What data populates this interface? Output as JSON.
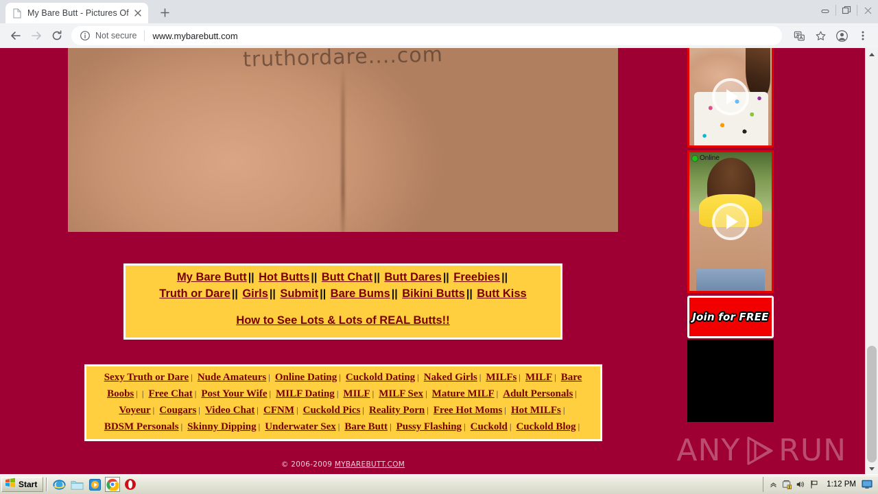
{
  "browser": {
    "tab": {
      "title": "My Bare Butt - Pictures Of College G",
      "favicon_name": "page-icon",
      "close_label": "✕"
    },
    "newtab_label": "+",
    "window_controls": {
      "minimize": "minimize",
      "restore": "restore",
      "close": "close"
    },
    "toolbar": {
      "back": "back",
      "forward": "forward",
      "reload": "reload",
      "security_text": "Not secure",
      "url": "www.mybarebutt.com",
      "translate": "translate",
      "bookmark": "bookmark",
      "profile": "profile",
      "menu": "menu"
    }
  },
  "page": {
    "background_color": "#9e0034",
    "hero": {
      "name": "hero-photo",
      "scrawl_text": "truthordare....com"
    },
    "navbox": {
      "background_color": "#ffcf3f",
      "row1": [
        "My Bare Butt",
        "Hot Butts",
        "Butt Chat",
        "Butt Dares",
        "Freebies"
      ],
      "row2": [
        "Truth or Dare",
        "Girls",
        "Submit",
        "Bare Bums",
        "Bikini Butts",
        "Butt Kiss"
      ],
      "separator": "||",
      "cta": "How to See Lots & Lots of REAL Butts!!"
    },
    "linkbox": {
      "background_color": "#ffcf3f",
      "separator": "|",
      "row1": [
        "Sexy Truth or Dare",
        "Nude Amateurs",
        "Online Dating",
        "Cuckold Dating",
        "Naked Girls",
        "MILFs",
        "MILF",
        "Bare"
      ],
      "row2": [
        "Boobs",
        "Free Chat",
        "Post Your Wife",
        "MILF Dating",
        "MILF",
        "MILF Sex",
        "Mature MILF",
        "Adult Personals"
      ],
      "row3": [
        "Voyeur",
        "Cougars",
        "Video Chat",
        "CFNM",
        "Cuckold Pics",
        "Reality Porn",
        "Free Hot Moms",
        "Hot MILFs"
      ],
      "row4": [
        "BDSM Personals",
        "Skinny Dipping",
        "Underwater Sex",
        "Bare Butt",
        "Pussy Flashing",
        "Cuckold",
        "Cuckold Blog"
      ]
    },
    "footer": {
      "copyright": "© 2006-2009 ",
      "site_link": "MYBAREBUTT.COM"
    },
    "sidebar": {
      "cam1": {
        "name": "cam-thumbnail-1",
        "play": "play"
      },
      "cam2": {
        "name": "cam-thumbnail-2",
        "play": "play",
        "status": "Online"
      },
      "join_banner": "Join for FREE"
    }
  },
  "watermark": {
    "left": "ANY",
    "right": "RUN"
  },
  "taskbar": {
    "start_label": "Start",
    "quicklaunch": [
      {
        "name": "internet-explorer-icon"
      },
      {
        "name": "folder-icon"
      },
      {
        "name": "media-player-icon"
      },
      {
        "name": "chrome-icon"
      },
      {
        "name": "opera-icon"
      }
    ],
    "tray": {
      "icons": [
        {
          "name": "chevron-up-icon"
        },
        {
          "name": "security-shield-icon"
        },
        {
          "name": "volume-icon"
        },
        {
          "name": "network-flag-icon"
        }
      ],
      "time": "1:12 PM",
      "show_desktop": "show-desktop"
    }
  }
}
